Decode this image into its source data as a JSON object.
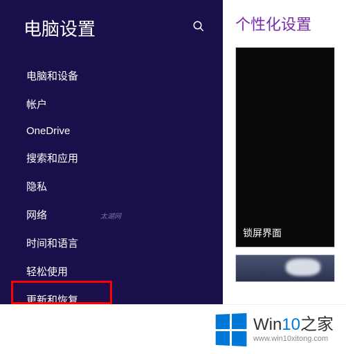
{
  "sidebar": {
    "title": "电脑设置",
    "search_icon": "search-icon",
    "items": [
      {
        "label": "电脑和设备"
      },
      {
        "label": "帐户"
      },
      {
        "label": "OneDrive"
      },
      {
        "label": "搜索和应用"
      },
      {
        "label": "隐私"
      },
      {
        "label": "网络"
      },
      {
        "label": "时间和语言"
      },
      {
        "label": "轻松使用"
      },
      {
        "label": "更新和恢复"
      }
    ],
    "watermark": "太湖网"
  },
  "right": {
    "title": "个性化设置",
    "tile1_label": "锁屏界面"
  },
  "footer": {
    "brand_prefix": "Win",
    "brand_num": "10",
    "brand_suffix": "之家",
    "url": "www.win10xitong.com"
  }
}
